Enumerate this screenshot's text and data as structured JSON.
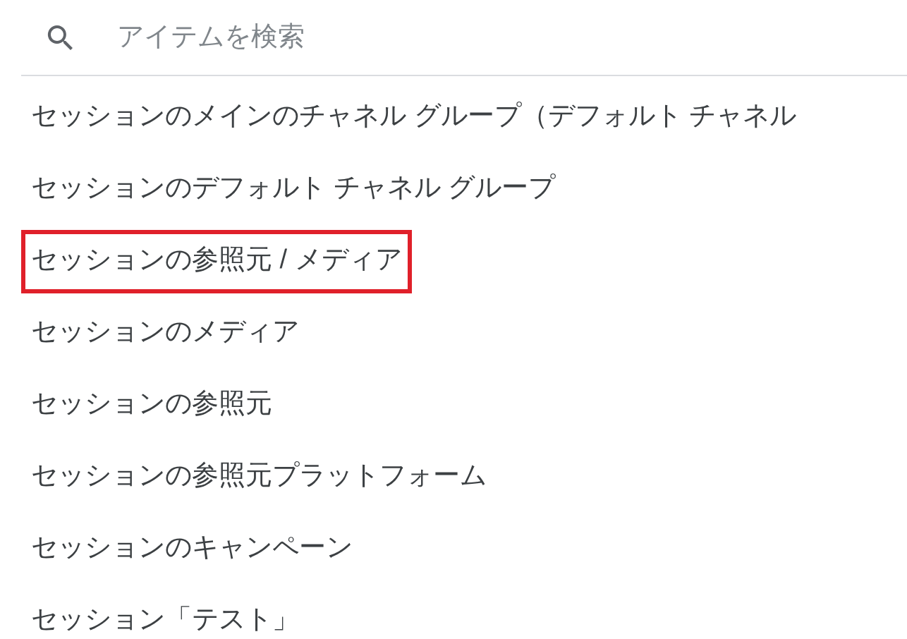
{
  "search": {
    "placeholder": "アイテムを検索"
  },
  "items": [
    {
      "label": "セッションのメインのチャネル グループ（デフォルト チャネル",
      "selected": false
    },
    {
      "label": "セッションのデフォルト チャネル グループ",
      "selected": false
    },
    {
      "label": "セッションの参照元 / メディア",
      "selected": true
    },
    {
      "label": "セッションのメディア",
      "selected": false
    },
    {
      "label": "セッションの参照元",
      "selected": false
    },
    {
      "label": "セッションの参照元プラットフォーム",
      "selected": false
    },
    {
      "label": "セッションのキャンペーン",
      "selected": false
    },
    {
      "label": "セッション「テスト」",
      "selected": false
    }
  ]
}
